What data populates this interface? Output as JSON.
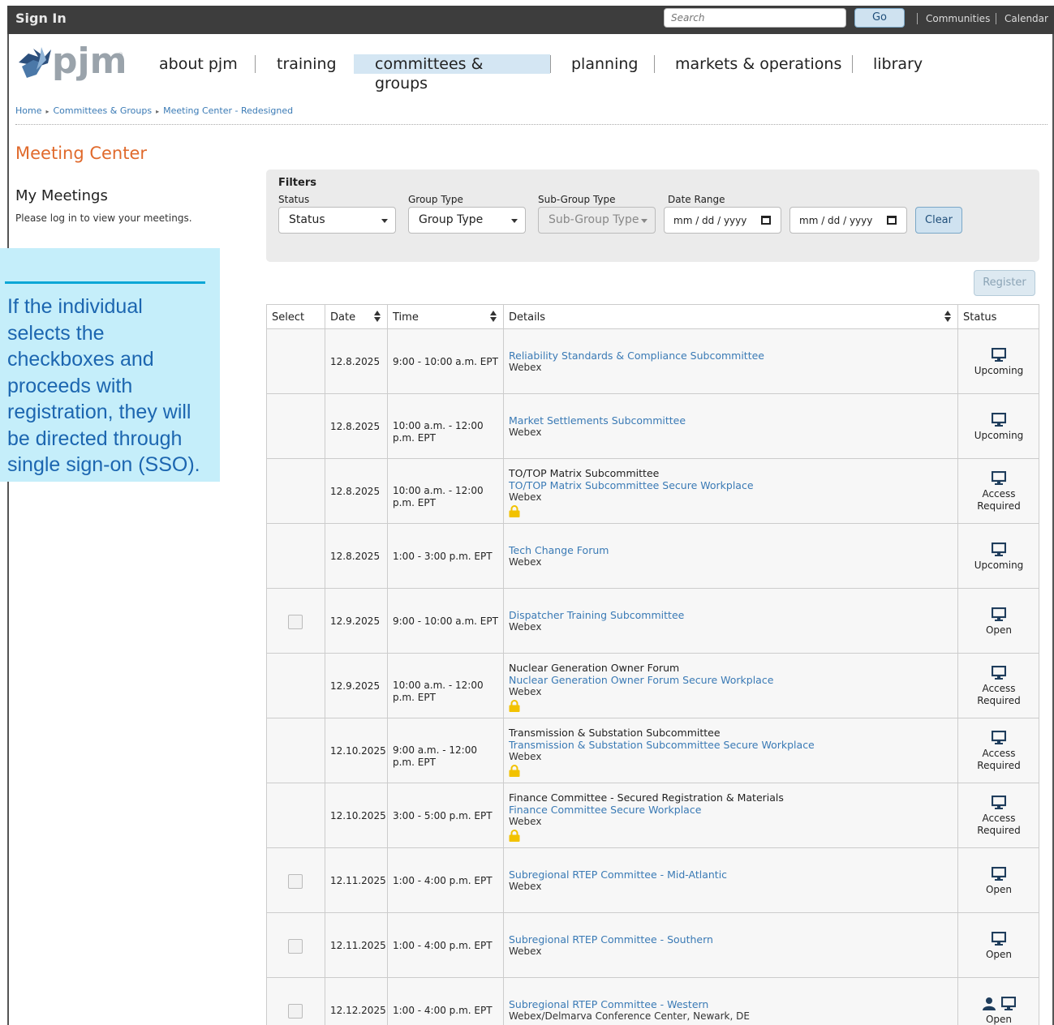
{
  "topbar": {
    "signin": "Sign In",
    "search_placeholder": "Search",
    "go": "Go",
    "links": [
      "Communities",
      "Calendar"
    ]
  },
  "nav": {
    "items": [
      "about pjm",
      "training",
      "committees & groups",
      "planning",
      "markets & operations",
      "library"
    ],
    "active": "committees & groups"
  },
  "breadcrumb": [
    "Home",
    "Committees & Groups",
    "Meeting Center - Redesigned"
  ],
  "page_title": "Meeting Center",
  "my_meetings": {
    "heading": "My Meetings",
    "text": "Please log in to view your meetings."
  },
  "callout": {
    "text": "If the individual selects the checkboxes and proceeds with registration, they will be directed through single sign-on (SSO)."
  },
  "filters": {
    "title": "Filters",
    "status": {
      "label": "Status",
      "value": "Status"
    },
    "group_type": {
      "label": "Group Type",
      "value": "Group Type"
    },
    "sub_group_type": {
      "label": "Sub-Group Type",
      "value": "Sub-Group Type"
    },
    "date_range": {
      "label": "Date Range",
      "from": "mm / dd / yyyy",
      "to": "mm / dd / yyyy"
    },
    "clear": "Clear"
  },
  "register": "Register",
  "table": {
    "headers": {
      "select": "Select",
      "date": "Date",
      "time": "Time",
      "details": "Details",
      "status": "Status"
    },
    "rows": [
      {
        "checkbox": false,
        "date": "12.8.2025",
        "time": [
          "9:00 - 10:00 a.m. EPT"
        ],
        "title": "",
        "link": "Reliability Standards & Compliance Subcommittee",
        "location": "Webex",
        "locked": false,
        "status": [
          "Upcoming"
        ]
      },
      {
        "checkbox": false,
        "date": "12.8.2025",
        "time": [
          "10:00 a.m. - 12:00",
          "p.m. EPT"
        ],
        "title": "",
        "link": "Market Settlements Subcommittee",
        "location": "Webex",
        "locked": false,
        "status": [
          "Upcoming"
        ]
      },
      {
        "checkbox": false,
        "date": "12.8.2025",
        "time": [
          "10:00 a.m. - 12:00",
          "p.m. EPT"
        ],
        "title": "TO/TOP Matrix Subcommittee",
        "link": "TO/TOP Matrix Subcommittee Secure Workplace",
        "location": "Webex",
        "locked": true,
        "status": [
          "Access",
          "Required"
        ]
      },
      {
        "checkbox": false,
        "date": "12.8.2025",
        "time": [
          "1:00 - 3:00 p.m. EPT"
        ],
        "title": "",
        "link": "Tech Change Forum",
        "location": "Webex",
        "locked": false,
        "status": [
          "Upcoming"
        ]
      },
      {
        "checkbox": true,
        "date": "12.9.2025",
        "time": [
          "9:00 - 10:00 a.m. EPT"
        ],
        "title": "",
        "link": "Dispatcher Training Subcommittee",
        "location": "Webex",
        "locked": false,
        "status": [
          "Open"
        ]
      },
      {
        "checkbox": false,
        "date": "12.9.2025",
        "time": [
          "10:00 a.m. - 12:00",
          "p.m. EPT"
        ],
        "title": "Nuclear Generation Owner Forum",
        "link": "Nuclear Generation Owner Forum Secure Workplace",
        "location": "Webex",
        "locked": true,
        "status": [
          "Access",
          "Required"
        ]
      },
      {
        "checkbox": false,
        "date": "12.10.2025",
        "time": [
          "9:00 a.m. - 12:00",
          "p.m. EPT"
        ],
        "title": "Transmission & Substation Subcommittee",
        "link": "Transmission & Substation Subcommittee Secure Workplace",
        "location": "Webex",
        "locked": true,
        "status": [
          "Access",
          "Required"
        ]
      },
      {
        "checkbox": false,
        "date": "12.10.2025",
        "time": [
          "3:00 - 5:00 p.m. EPT"
        ],
        "title": "Finance Committee - Secured Registration & Materials",
        "link": "Finance Committee Secure Workplace",
        "location": "Webex",
        "locked": true,
        "status": [
          "Access",
          "Required"
        ]
      },
      {
        "checkbox": true,
        "date": "12.11.2025",
        "time": [
          "1:00 - 4:00 p.m. EPT"
        ],
        "title": "",
        "link": "Subregional RTEP Committee - Mid-Atlantic",
        "location": "Webex",
        "locked": false,
        "status": [
          "Open"
        ]
      },
      {
        "checkbox": true,
        "date": "12.11.2025",
        "time": [
          "1:00 - 4:00 p.m. EPT"
        ],
        "title": "",
        "link": "Subregional RTEP Committee - Southern",
        "location": "Webex",
        "locked": false,
        "status": [
          "Open"
        ]
      },
      {
        "checkbox": true,
        "date": "12.12.2025",
        "time": [
          "1:00 - 4:00 p.m. EPT"
        ],
        "title": "",
        "link": "Subregional RTEP Committee - Western",
        "location": "Webex/Delmarva Conference Center, Newark, DE",
        "locked": false,
        "in_person": true,
        "status": [
          "Open"
        ]
      }
    ]
  },
  "colors": {
    "accent_orange": "#e06a2c",
    "link_blue": "#3a7ab5",
    "callout_bg": "#c5eefa",
    "callout_text": "#1c66b0",
    "lock_yellow": "#f2c200",
    "icon_navy": "#1f3d5c"
  }
}
